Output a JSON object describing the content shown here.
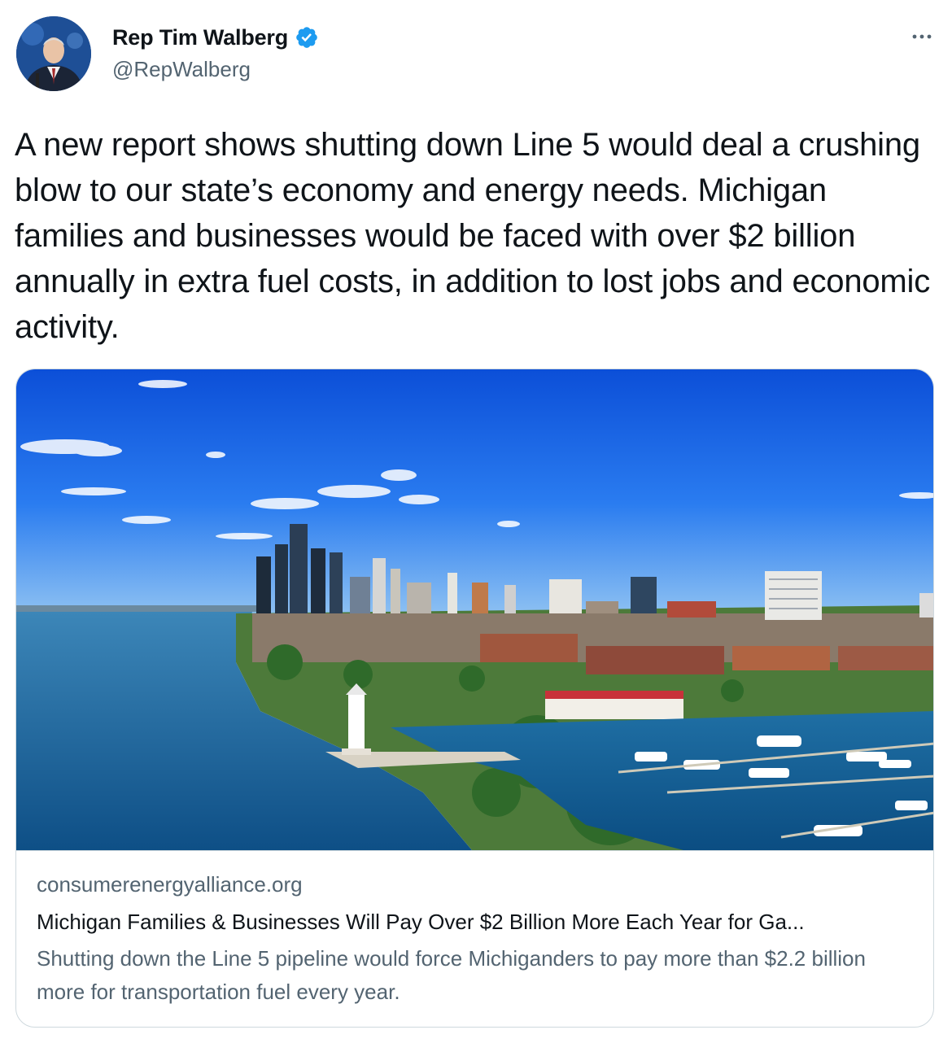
{
  "author": {
    "display_name": "Rep Tim Walberg",
    "handle": "@RepWalberg",
    "avatar_icon": "profile-photo",
    "verified_icon": "verified-badge-icon"
  },
  "menu": {
    "icon": "more-horizontal-icon"
  },
  "tweet": {
    "text": "A new report shows shutting down Line 5 would deal a crushing blow to our state’s economy and energy needs. Michigan families and businesses would be faced with over $2 billion annually in extra fuel costs, in addition to lost jobs and economic activity."
  },
  "link_card": {
    "domain": "consumerenergyalliance.org",
    "title": "Michigan Families & Businesses Will Pay Over $2 Billion More Each Year for Ga...",
    "description": "Shutting down the Line 5 pipeline would force Michiganders to pay more than $2.2 billion more for transportation fuel every year."
  },
  "colors": {
    "verified": "#1d9bf0",
    "secondary_text": "#536471",
    "border": "#cfd9de"
  }
}
